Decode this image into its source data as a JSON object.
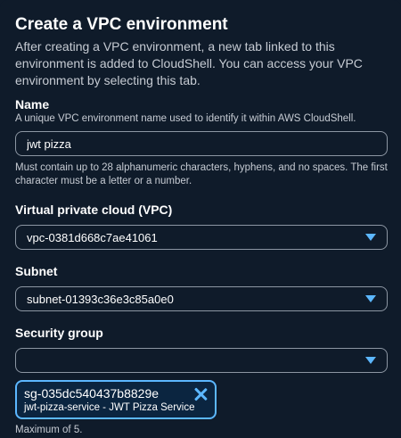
{
  "header": {
    "title": "Create a VPC environment",
    "description": "After creating a VPC environment, a new tab linked to this environment is added to CloudShell. You can access your VPC environment by selecting this tab."
  },
  "name_field": {
    "label": "Name",
    "description": "A unique VPC environment name used to identify it within AWS CloudShell.",
    "value": "jwt pizza",
    "hint": "Must contain up to 28 alphanumeric characters, hyphens, and no spaces. The first character must be a letter or a number."
  },
  "vpc_field": {
    "label": "Virtual private cloud (VPC)",
    "selected": "vpc-0381d668c7ae41061"
  },
  "subnet_field": {
    "label": "Subnet",
    "selected": "subnet-01393c36e3c85a0e0"
  },
  "security_group_field": {
    "label": "Security group",
    "selected": "",
    "token": {
      "id": "sg-035dc540437b8829e",
      "detail": "jwt-pizza-service - JWT Pizza Service"
    },
    "constraint": "Maximum of 5."
  },
  "icons": {
    "dropdown": "caret-down-icon",
    "remove": "close-icon"
  },
  "colors": {
    "background": "#0f1b2a",
    "accent": "#5cb7ff",
    "border": "#8c96a3",
    "token_bg": "#0b2540"
  }
}
